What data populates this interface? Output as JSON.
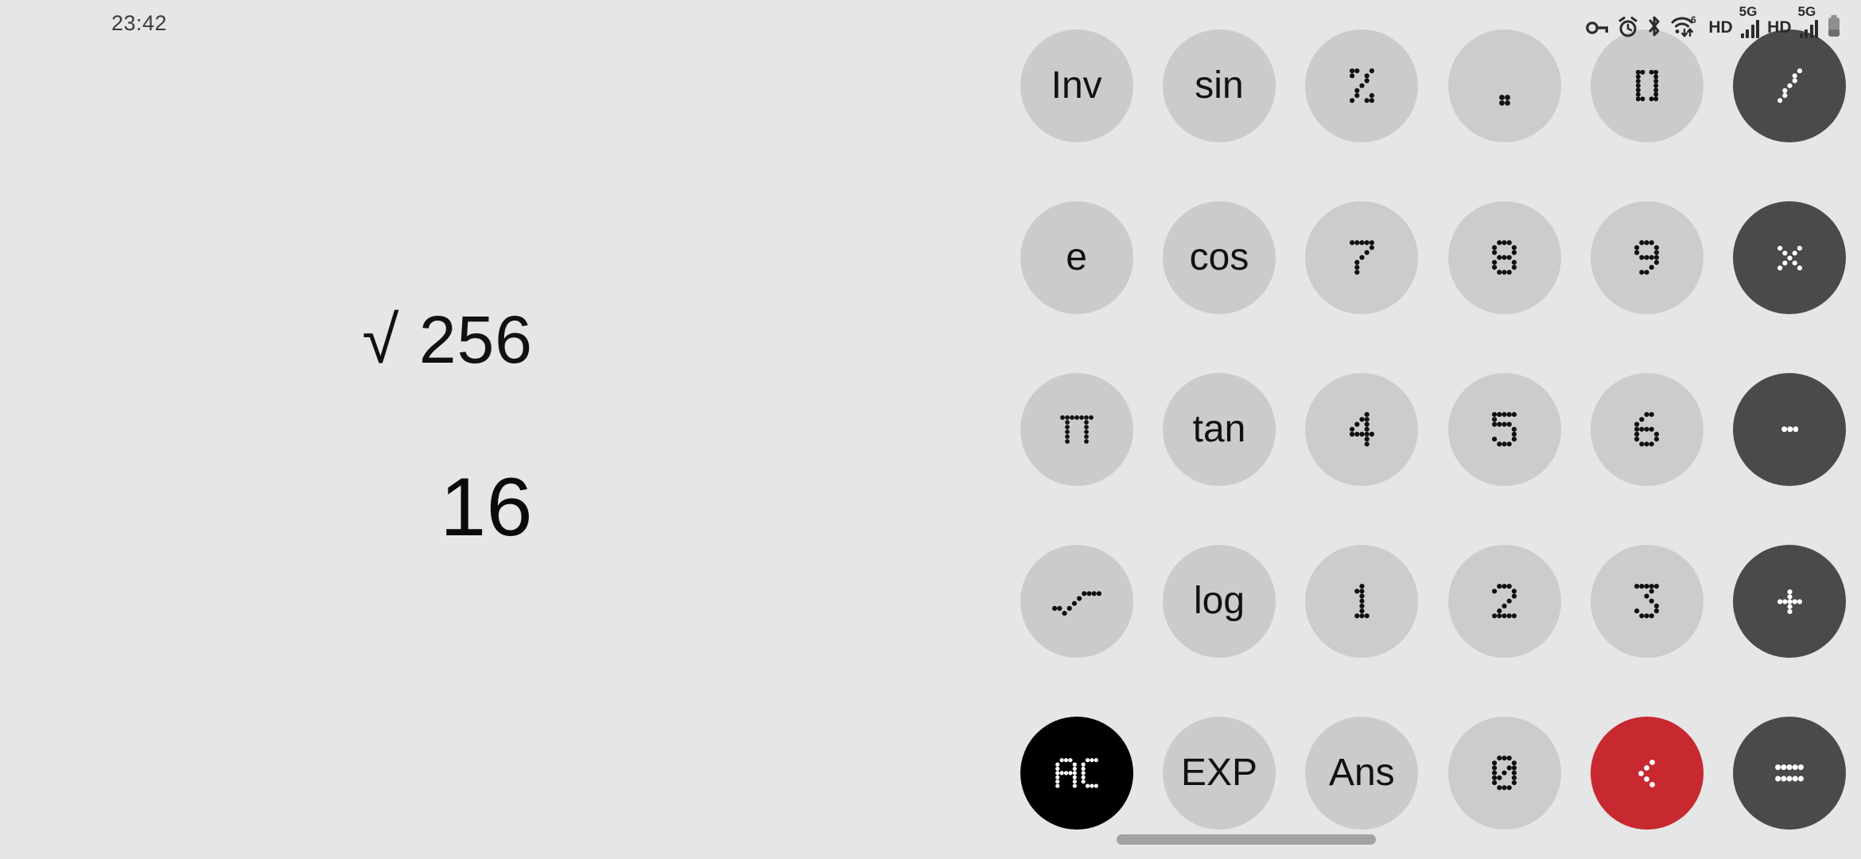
{
  "status_bar": {
    "clock": "23:42",
    "icons": [
      {
        "name": "vpn-key-icon",
        "label": "VPN"
      },
      {
        "name": "alarm-clock-icon",
        "label": "Alarm"
      },
      {
        "name": "bluetooth-icon",
        "label": "Bluetooth"
      },
      {
        "name": "wifi-6-icon",
        "label": "Wi-Fi 6"
      },
      {
        "name": "hd-voice-icon",
        "label": "HD"
      },
      {
        "name": "signal-5g-sim1-icon",
        "label": "5G"
      },
      {
        "name": "hd-voice-2-icon",
        "label": "HD"
      },
      {
        "name": "signal-5g-sim2-icon",
        "label": "5G"
      },
      {
        "name": "battery-icon",
        "label": "Battery"
      }
    ],
    "hd_label": "HD",
    "fiveg_label": "5G",
    "wifi_gen": "6"
  },
  "display": {
    "expression": "√ 256",
    "result": "16"
  },
  "colors": {
    "background": "#e6e6e6",
    "key_default": "#cccccc",
    "key_operator": "#4a4a4a",
    "key_clear": "#000000",
    "key_delete": "#c8282f",
    "text_primary": "#111111",
    "text_on_dark": "#ffffff",
    "nav_pill": "#a2a2a2"
  },
  "keypad": {
    "rows": [
      [
        {
          "label": "Inv",
          "name": "key-inv",
          "style": "fn",
          "glyph": "text"
        },
        {
          "label": "sin",
          "name": "key-sin",
          "style": "fn",
          "glyph": "text"
        },
        {
          "label": "%",
          "name": "key-percent",
          "style": "fn",
          "glyph": "led-percent"
        },
        {
          "label": ".",
          "name": "key-decimal",
          "style": "num",
          "glyph": "led-dot"
        },
        {
          "label": "( )",
          "name": "key-parenthesis",
          "style": "fn",
          "glyph": "led-paren"
        },
        {
          "label": "÷",
          "name": "key-divide",
          "style": "op",
          "glyph": "led-divide"
        }
      ],
      [
        {
          "label": "e",
          "name": "key-e",
          "style": "fn",
          "glyph": "text"
        },
        {
          "label": "cos",
          "name": "key-cos",
          "style": "fn",
          "glyph": "text"
        },
        {
          "label": "7",
          "name": "key-7",
          "style": "num",
          "glyph": "led-7"
        },
        {
          "label": "8",
          "name": "key-8",
          "style": "num",
          "glyph": "led-8"
        },
        {
          "label": "9",
          "name": "key-9",
          "style": "num",
          "glyph": "led-9"
        },
        {
          "label": "×",
          "name": "key-multiply",
          "style": "op",
          "glyph": "led-multiply"
        }
      ],
      [
        {
          "label": "π",
          "name": "key-pi",
          "style": "fn",
          "glyph": "led-pi"
        },
        {
          "label": "tan",
          "name": "key-tan",
          "style": "fn",
          "glyph": "text"
        },
        {
          "label": "4",
          "name": "key-4",
          "style": "num",
          "glyph": "led-4"
        },
        {
          "label": "5",
          "name": "key-5",
          "style": "num",
          "glyph": "led-5"
        },
        {
          "label": "6",
          "name": "key-6",
          "style": "num",
          "glyph": "led-6"
        },
        {
          "label": "−",
          "name": "key-subtract",
          "style": "op",
          "glyph": "led-minus"
        }
      ],
      [
        {
          "label": "√",
          "name": "key-sqrt",
          "style": "fn",
          "glyph": "led-sqrt"
        },
        {
          "label": "log",
          "name": "key-log",
          "style": "fn",
          "glyph": "text"
        },
        {
          "label": "1",
          "name": "key-1",
          "style": "num",
          "glyph": "led-1"
        },
        {
          "label": "2",
          "name": "key-2",
          "style": "num",
          "glyph": "led-2"
        },
        {
          "label": "3",
          "name": "key-3",
          "style": "num",
          "glyph": "led-3"
        },
        {
          "label": "+",
          "name": "key-add",
          "style": "op",
          "glyph": "led-plus"
        }
      ],
      [
        {
          "label": "AC",
          "name": "key-all-clear",
          "style": "clear",
          "glyph": "led-ac"
        },
        {
          "label": "EXP",
          "name": "key-exp",
          "style": "fn",
          "glyph": "text"
        },
        {
          "label": "Ans",
          "name": "key-ans",
          "style": "fn",
          "glyph": "text"
        },
        {
          "label": "0",
          "name": "key-0",
          "style": "num",
          "glyph": "led-0"
        },
        {
          "label": "⌫",
          "name": "key-backspace",
          "style": "del",
          "glyph": "led-backspace"
        },
        {
          "label": "=",
          "name": "key-equals",
          "style": "op",
          "glyph": "led-equals"
        }
      ]
    ]
  },
  "nav": {
    "pill_label": "home-gesture-pill"
  }
}
